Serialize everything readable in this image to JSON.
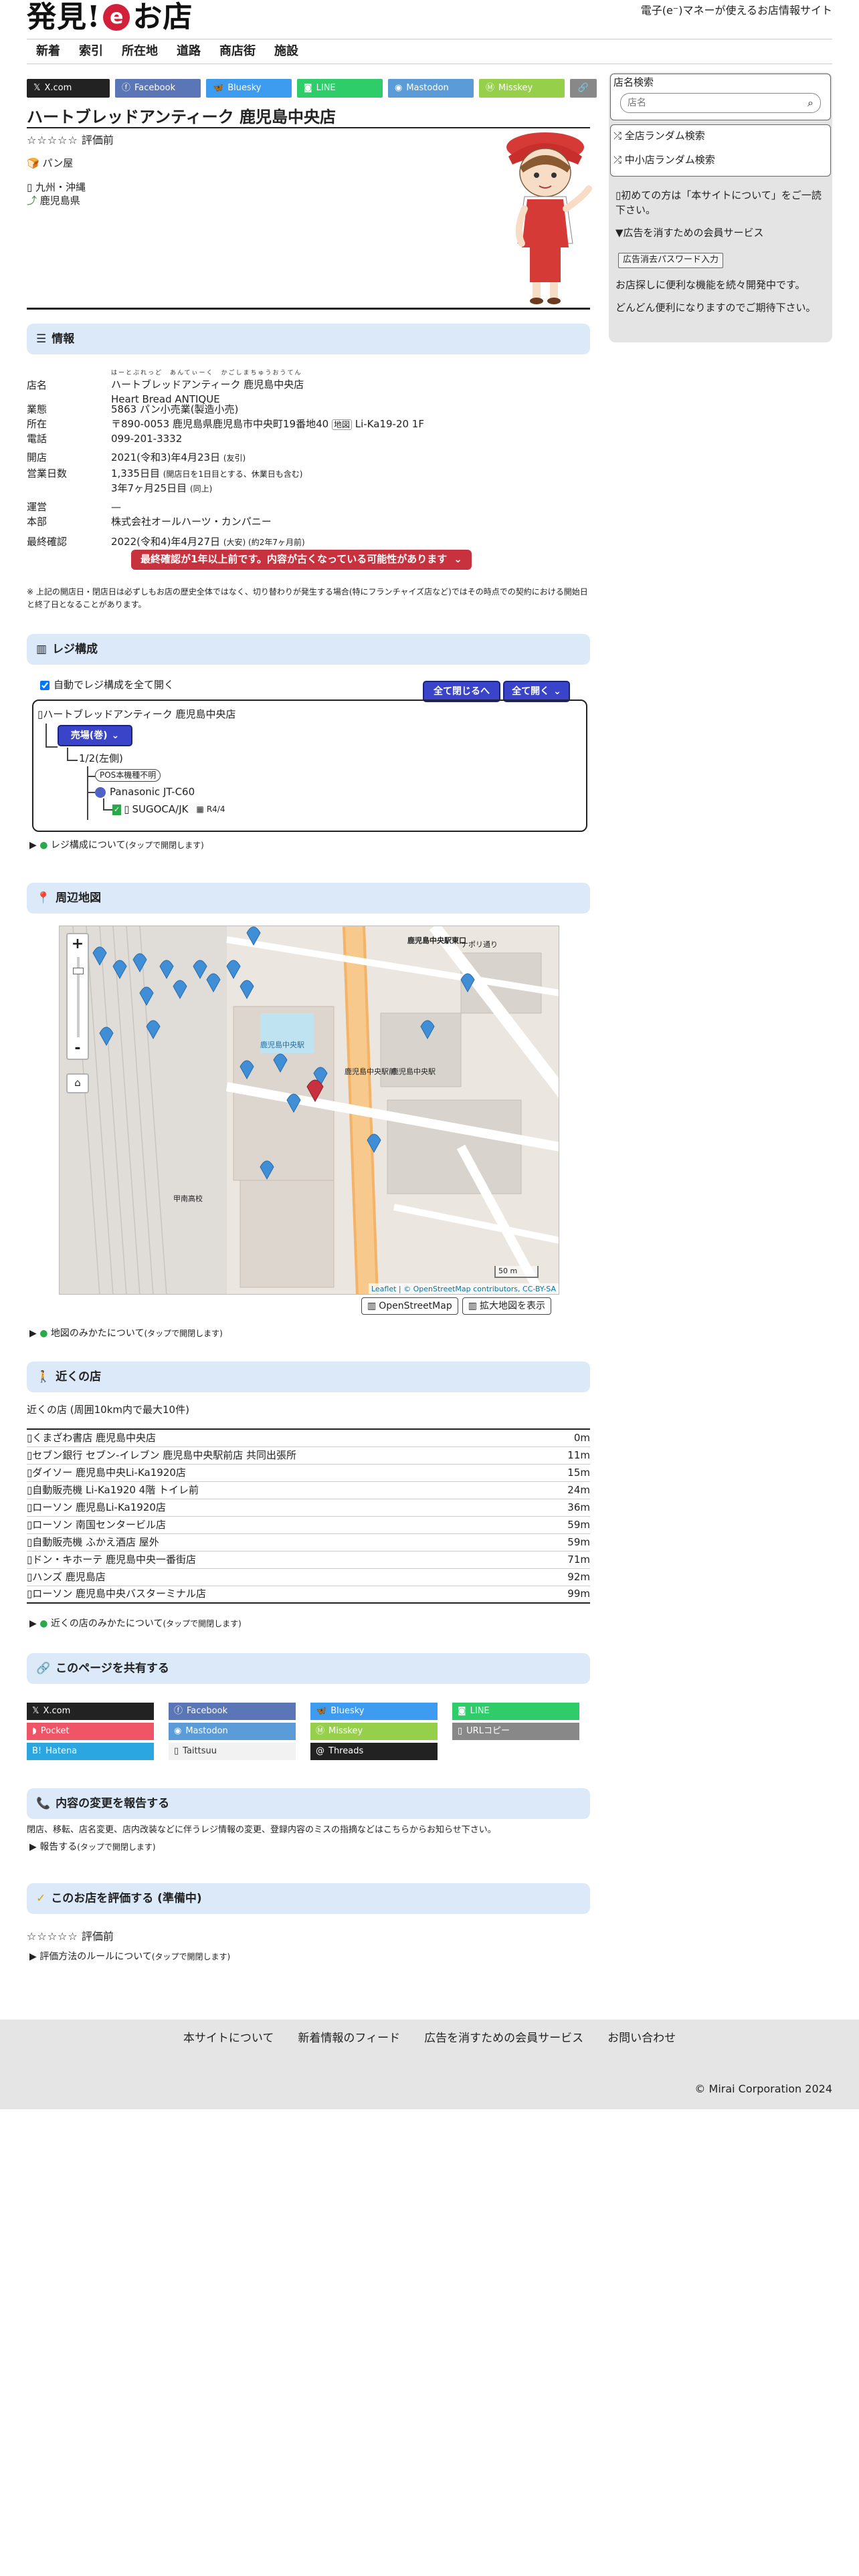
{
  "site": {
    "logo_pre": "発見!",
    "logo_e": "e",
    "logo_post": "お店",
    "tagline": "電子(e⁻)マネーが使えるお店情報サイト"
  },
  "nav": [
    "新着",
    "索引",
    "所在地",
    "道路",
    "商店街",
    "施設"
  ],
  "share_top": [
    {
      "label": "X.com",
      "color": "#222222"
    },
    {
      "label": "Facebook",
      "color": "#5b76b7"
    },
    {
      "label": "Bluesky",
      "color": "#3d9cf0"
    },
    {
      "label": "LINE",
      "color": "#2fcc6a"
    },
    {
      "label": "Mastodon",
      "color": "#5b9bd7"
    },
    {
      "label": "Misskey",
      "color": "#96d04a"
    }
  ],
  "title": "ハートブレッドアンティーク 鹿児島中央店",
  "rating": {
    "stars": "☆☆☆☆☆",
    "label": "評価前"
  },
  "category": "パン屋",
  "region": "九州・沖縄",
  "pref": "鹿児島県",
  "sections": {
    "info": "情報",
    "register": "レジ構成",
    "map": "周辺地図",
    "nearby": "近くの店",
    "share": "このページを共有する",
    "report": "内容の変更を報告する",
    "evaluate": "このお店を評価する (準備中)"
  },
  "info": {
    "name_key": "店名",
    "name_ruby": "はーとぶれっど　あんてぃーく　かごしまちゅうおうてん",
    "name": "ハートブレッドアンティーク 鹿児島中央店",
    "name_en": "Heart Bread ANTIQUE",
    "type_key": "業態",
    "type": "5863 パン小売業(製造小売)",
    "addr_key": "所在",
    "addr": "〒890-0053 鹿児島県鹿児島市中央町19番地40",
    "addr_tag": "地図",
    "addr_bldg": "Li-Ka19-20 1F",
    "tel_key": "電話",
    "tel": "099-201-3332",
    "open_key": "開店",
    "open": "2021(令和3)年4月23日",
    "open_day": "(友引)",
    "days_key": "営業日数",
    "days": "1,335日目",
    "days_note": "(開店日を1日目とする、休業日も含む)",
    "days2": "3年7ヶ月25日目",
    "days2_note": "(同上)",
    "ops_key": "運営",
    "ops": "—",
    "hq_key": "本部",
    "hq": "株式会社オールハーツ・カンパニー",
    "check_key": "最終確認",
    "check": "2022(令和4)年4月27日",
    "check_note": "(大安) (約2年7ヶ月前)",
    "warn": "最終確認が1年以上前です。内容が古くなっている可能性があります",
    "footnote": "※ 上記の開店日・閉店日は必ずしもお店の歴史全体ではなく、切り替わりが発生する場合(特にフランチャイズ店など)ではその時点での契約における開始日と終了日となることがあります。"
  },
  "register": {
    "auto_open": "自動でレジ構成を全て開く",
    "close_all": "全て閉じるへ",
    "open_all": "全て開く",
    "root": "ハートブレッドアンティーク 鹿児島中央店",
    "counter": "売場(巻)",
    "lane": "1/2(左側)",
    "pos": "POS本機種不明",
    "terminal": "Panasonic JT-C60",
    "brand": "SUGOCA/JK",
    "brand_note": "R4/4",
    "about": "レジ構成について",
    "about_note": "(タップで開閉します)"
  },
  "map": {
    "zoom_in": "+",
    "zoom_out": "-",
    "scale": "50 m",
    "attrib": "Leaflet | © OpenStreetMap contributors, CC-BY-SA",
    "osm_btn": "OpenStreetMap",
    "big_btn": "拡大地図を表示",
    "about": "地図のみかたについて",
    "about_note": "(タップで開閉します)",
    "labels": [
      "鹿児島中央駅",
      "甲南高校",
      "鹿児島中央駅前",
      "鹿児島中央駅",
      "ナポリ通り",
      "鹿児島中央駅東口"
    ]
  },
  "nearby": {
    "heading": "近くの店 (周囲10km内で最大10件)",
    "rows": [
      {
        "name": "くまざわ書店 鹿児島中央店",
        "dist": "0m"
      },
      {
        "name": "セブン銀行 セブン-イレブン 鹿児島中央駅前店 共同出張所",
        "dist": "11m"
      },
      {
        "name": "ダイソー 鹿児島中央Li-Ka1920店",
        "dist": "15m"
      },
      {
        "name": "自動販売機 Li-Ka1920 4階 トイレ前",
        "dist": "24m"
      },
      {
        "name": "ローソン 鹿児島Li-Ka1920店",
        "dist": "36m"
      },
      {
        "name": "ローソン 南国センタービル店",
        "dist": "59m"
      },
      {
        "name": "自動販売機 ふかえ酒店 屋外",
        "dist": "59m"
      },
      {
        "name": "ドン・キホーテ 鹿児島中央一番街店",
        "dist": "71m"
      },
      {
        "name": "ハンズ 鹿児島店",
        "dist": "92m"
      },
      {
        "name": "ローソン 鹿児島中央バスターミナル店",
        "dist": "99m"
      }
    ],
    "about": "近くの店のみかたについて",
    "about_note": "(タップで開閉します)"
  },
  "share_grid": [
    {
      "label": "X.com",
      "color": "#222222",
      "fg": "#ffffff"
    },
    {
      "label": "Facebook",
      "color": "#5b76b7",
      "fg": "#ffffff"
    },
    {
      "label": "Bluesky",
      "color": "#3d9cf0",
      "fg": "#ffffff"
    },
    {
      "label": "LINE",
      "color": "#2fcc6a",
      "fg": "#ffffff"
    },
    {
      "label": "Pocket",
      "color": "#ef5567",
      "fg": "#ffffff"
    },
    {
      "label": "Mastodon",
      "color": "#5b9bd7",
      "fg": "#ffffff"
    },
    {
      "label": "Misskey",
      "color": "#96d04a",
      "fg": "#ffffff"
    },
    {
      "label": "URLコピー",
      "color": "#888888",
      "fg": "#ffffff"
    },
    {
      "label": "Hatena",
      "color": "#2ba6e0",
      "fg": "#ffffff"
    },
    {
      "label": "Taittsuu",
      "color": "#f2f2f2",
      "fg": "#333333"
    },
    {
      "label": "Threads",
      "color": "#222222",
      "fg": "#ffffff"
    }
  ],
  "report": {
    "desc": "閉店、移転、店名変更、店内改装などに伴うレジ情報の変更、登録内容のミスの指摘などはこちらからお知らせ下さい。",
    "link": "報告する",
    "link_note": "(タップで開閉します)"
  },
  "evaluate": {
    "stars": "☆☆☆☆☆",
    "label": "評価前",
    "rules": "評価方法のルールについて",
    "rules_note": "(タップで開閉します)"
  },
  "sidebar": {
    "search_title": "店名検索",
    "search_placeholder": "店名",
    "random_all": "全店ランダム検索",
    "random_small": "中小店ランダム検索",
    "first_visit": "初めての方は「本サイトについて」をご一読下さい。",
    "ads_title": "▼広告を消すための会員サービス",
    "ads_btn": "広告消去パスワード入力",
    "ads_text1": "お店探しに便利な機能を続々開発中です。",
    "ads_text2": "どんどん便利になりますのでご期待下さい。"
  },
  "footer": {
    "links": [
      "本サイトについて",
      "新着情報のフィード",
      "広告を消すための会員サービス",
      "お問い合わせ"
    ],
    "copy": "© Mirai Corporation 2024"
  }
}
